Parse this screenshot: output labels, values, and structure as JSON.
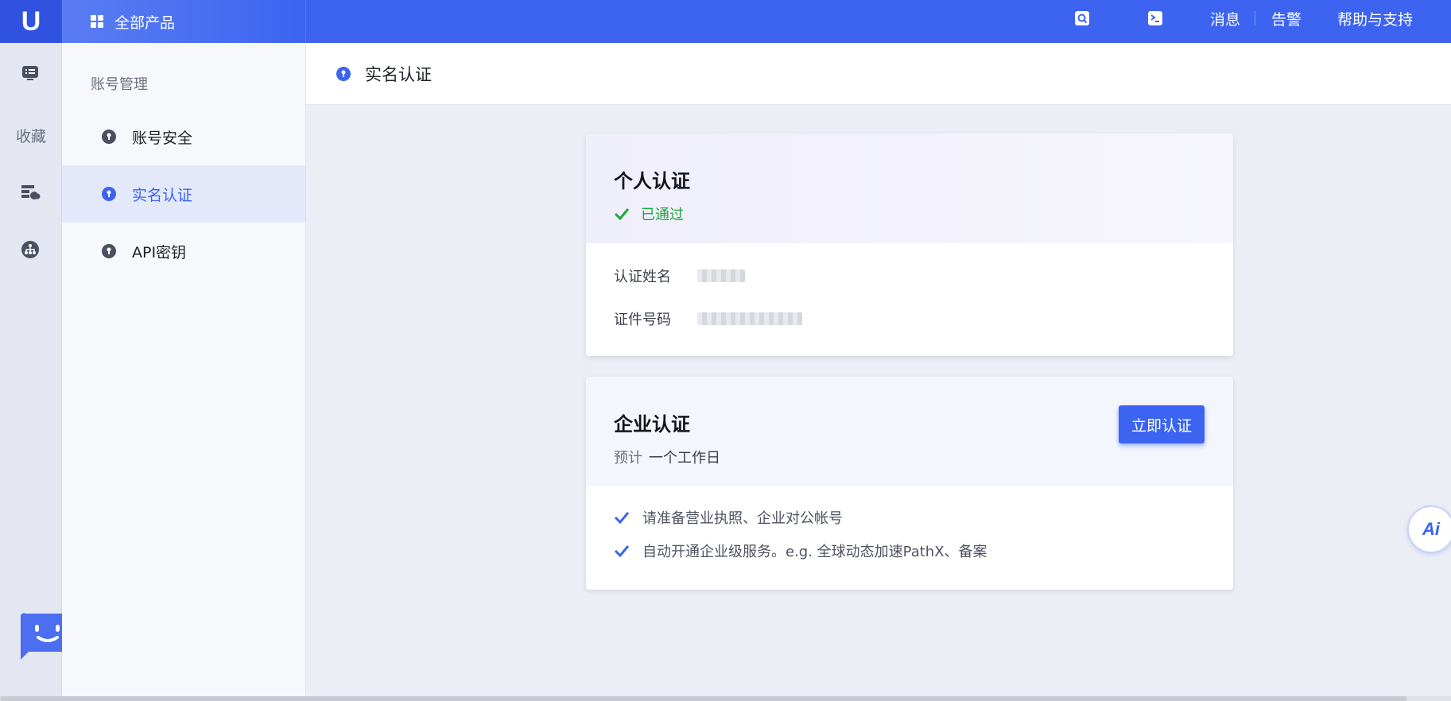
{
  "brand": {
    "logo_letter": "U",
    "accent": "#3c64f0"
  },
  "rail": {
    "favorites_label": "收藏",
    "icons": [
      "monitor-list-icon",
      "server-cloud-icon",
      "network-icon"
    ]
  },
  "topbar": {
    "all_products": "全部产品",
    "messages": "消息",
    "alerts": "告警",
    "help": "帮助与支持",
    "icons": [
      "search-icon",
      "terminal-icon"
    ]
  },
  "subnav": {
    "title": "账号管理",
    "items": [
      {
        "label": "账号安全",
        "active": false
      },
      {
        "label": "实名认证",
        "active": true
      },
      {
        "label": "API密钥",
        "active": false
      }
    ]
  },
  "page": {
    "title": "实名认证"
  },
  "personal": {
    "title": "个人认证",
    "status": "已通过",
    "status_color": "#1fa83b",
    "fields": [
      {
        "label": "认证姓名"
      },
      {
        "label": "证件号码"
      }
    ]
  },
  "enterprise": {
    "title": "企业认证",
    "estimate_label": "预计",
    "estimate_value": "一个工作日",
    "action": "立即认证",
    "notes": [
      "请准备营业执照、企业对公帐号",
      "自动开通企业级服务。e.g. 全球动态加速PathX、备案"
    ]
  },
  "ai_assistant": {
    "label": "Ai"
  }
}
